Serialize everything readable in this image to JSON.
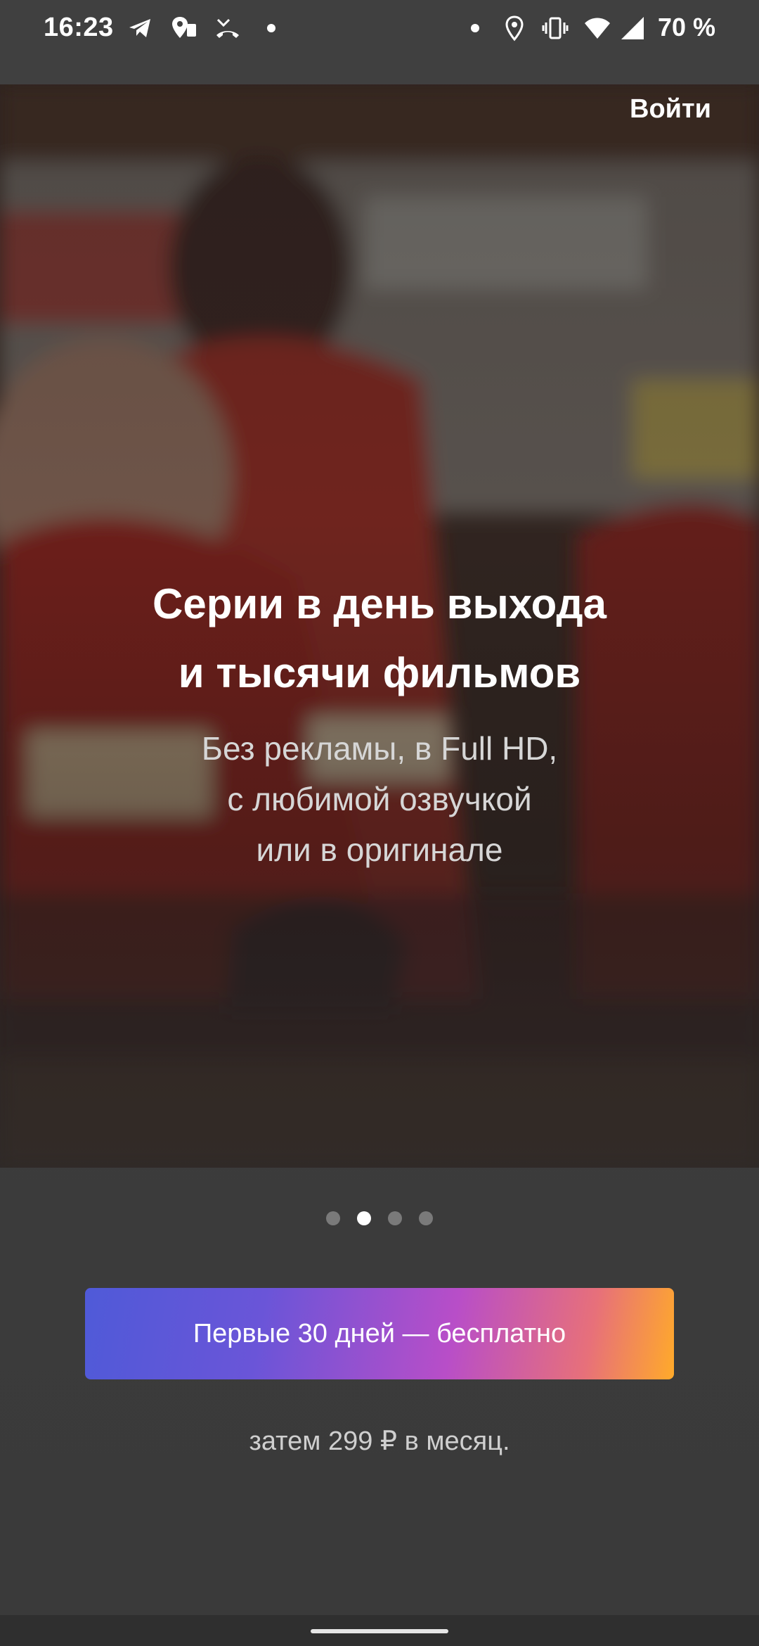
{
  "status_bar": {
    "time": "16:23",
    "battery": "70 %",
    "left_icons": [
      "telegram-icon",
      "maps-icon",
      "missed-call-icon",
      "dot-icon"
    ],
    "right_icons": [
      "dot-icon",
      "location-icon",
      "vibrate-icon",
      "wifi-icon",
      "signal-icon"
    ]
  },
  "header": {
    "login_label": "Войти"
  },
  "promo": {
    "headline_line1": "Серии в день выхода",
    "headline_line2": "и тысячи фильмов",
    "sub_line1": "Без рекламы, в Full HD,",
    "sub_line2": "с любимой озвучкой",
    "sub_line3": "или в оригинале"
  },
  "carousel": {
    "count": 4,
    "active_index": 1
  },
  "cta": {
    "label": "Первые 30 дней — бесплатно",
    "gradient": [
      "#4f5ad8",
      "#b84ec8",
      "#ffaa2a"
    ]
  },
  "pricing": {
    "note": "затем 299 ₽ в месяц."
  },
  "colors": {
    "background": "#3b3b3b",
    "text_primary": "#ffffff",
    "text_secondary": "#d6d6d6"
  }
}
